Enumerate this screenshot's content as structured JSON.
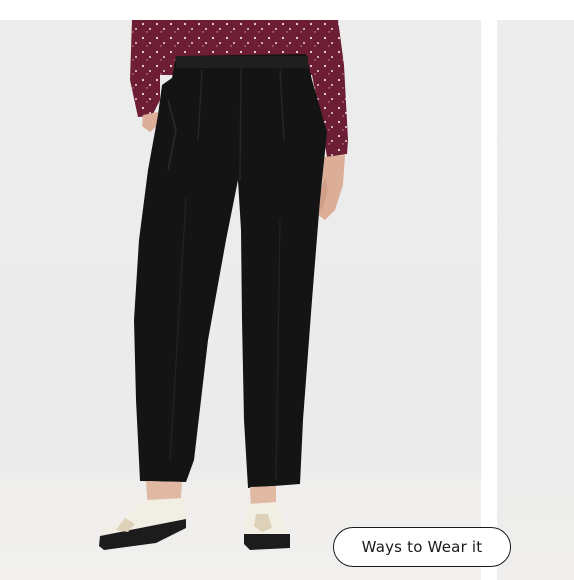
{
  "carousel": {
    "wear_button_label": "Ways to Wear it"
  },
  "colors": {
    "blouse": "#6e1e34",
    "pants": "#141414",
    "shoe": "#f1eee3",
    "sole": "#1c1c1c",
    "background": "#ececec"
  },
  "icons": {
    "product_photo": "product-image"
  }
}
